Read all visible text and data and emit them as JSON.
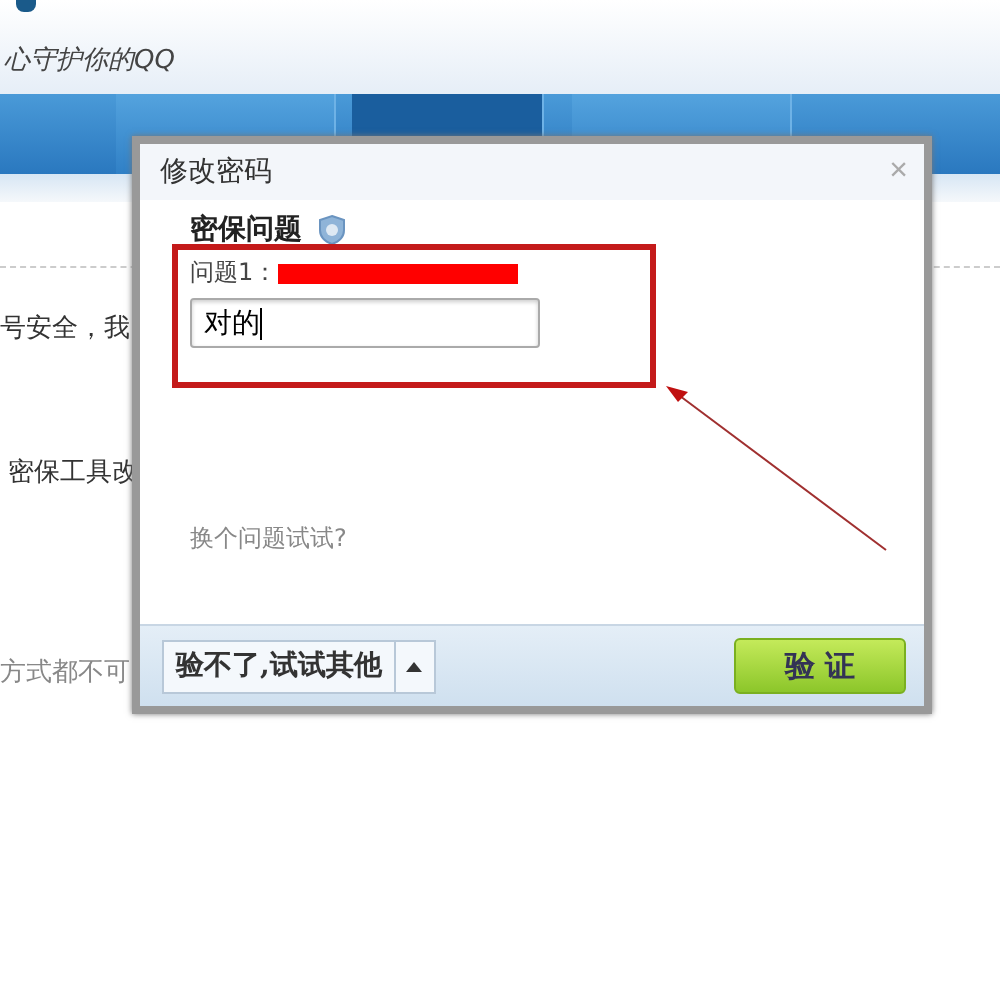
{
  "header": {
    "slogan": "心守护你的QQ"
  },
  "tabs": [
    {
      "selected": false
    },
    {
      "selected": true
    },
    {
      "selected": false
    }
  ],
  "content": {
    "lines": [
      "号安全，我",
      "密保工具改",
      "方式都不可"
    ]
  },
  "dialog": {
    "title": "修改密码",
    "close": "×",
    "section_title": "密保问题",
    "question_label": "问题1：",
    "answer": "对的",
    "switch_link": "换个问题试试?",
    "other_button": "验不了,试试其他",
    "verify_button": "验 证"
  }
}
